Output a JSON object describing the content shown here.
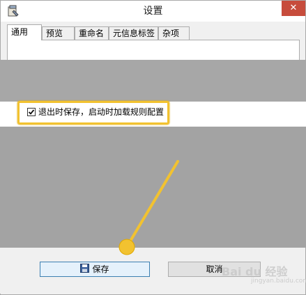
{
  "window": {
    "title": "设置",
    "close_glyph": "✕",
    "app_icon": "settings-app-icon"
  },
  "tabs": [
    {
      "label": "通用",
      "active": true
    },
    {
      "label": "预览",
      "active": false
    },
    {
      "label": "重命名",
      "active": false
    },
    {
      "label": "元信息标签",
      "active": false
    },
    {
      "label": "杂项",
      "active": false
    }
  ],
  "general": {
    "save_on_exit_checkbox": {
      "label": "退出时保存，启动时加载规则配置",
      "checked": true
    }
  },
  "buttons": {
    "save_label": "保存",
    "cancel_label": "取消",
    "save_icon": "floppy-disk-icon"
  },
  "annotation": {
    "highlight_color": "#f2c230",
    "arrow_color": "#f2c230"
  },
  "watermark": {
    "text": "Bai du 经验",
    "sub": "jingyan.baidu.com"
  }
}
